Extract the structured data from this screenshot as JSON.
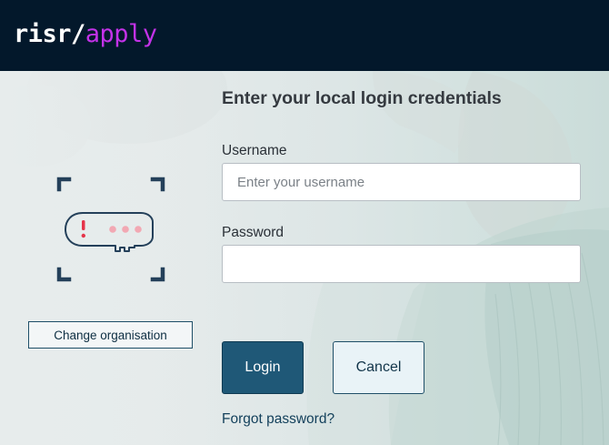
{
  "header": {
    "logo_primary": "risr/",
    "logo_secondary": "apply"
  },
  "left_panel": {
    "illustration_icon": "key-icon",
    "change_org_label": "Change organisation"
  },
  "form": {
    "title": "Enter your local login credentials",
    "username": {
      "label": "Username",
      "placeholder": "Enter your username",
      "value": ""
    },
    "password": {
      "label": "Password",
      "placeholder": "",
      "value": ""
    },
    "login_label": "Login",
    "cancel_label": "Cancel",
    "forgot_label": "Forgot password?"
  },
  "colors": {
    "header_bg": "#03182b",
    "logo_accent": "#c332e8",
    "primary_button": "#1f5877",
    "key_alert": "#e5344a"
  }
}
